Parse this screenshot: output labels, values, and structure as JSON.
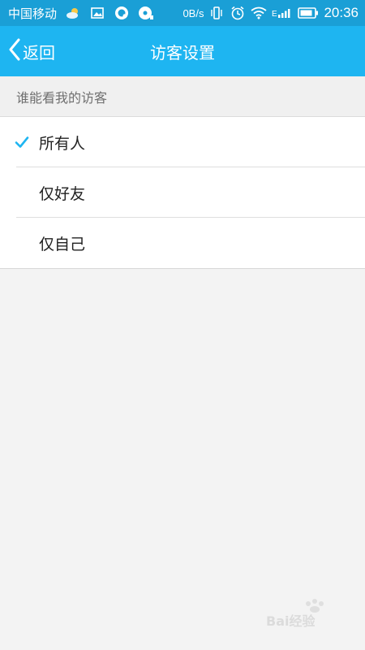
{
  "status_bar": {
    "carrier": "中国移动",
    "speed": "0B/s",
    "time": "20:36",
    "signal_label": "E",
    "icons": [
      "cloud-weather-icon",
      "image-icon",
      "q-app-icon",
      "music-disc-icon",
      "vibrate-icon",
      "alarm-icon",
      "wifi-icon",
      "signal-icon",
      "battery-icon"
    ]
  },
  "title_bar": {
    "back_label": "返回",
    "title": "访客设置"
  },
  "section": {
    "header": "谁能看我的访客",
    "options": [
      {
        "label": "所有人",
        "selected": true
      },
      {
        "label": "仅好友",
        "selected": false
      },
      {
        "label": "仅自己",
        "selected": false
      }
    ]
  },
  "colors": {
    "status_bar": "#1a9fd6",
    "title_bar": "#1eb5f1",
    "accent_check": "#1eb5f1",
    "background": "#f3f3f3"
  },
  "watermark": {
    "text": "Bai经验"
  }
}
